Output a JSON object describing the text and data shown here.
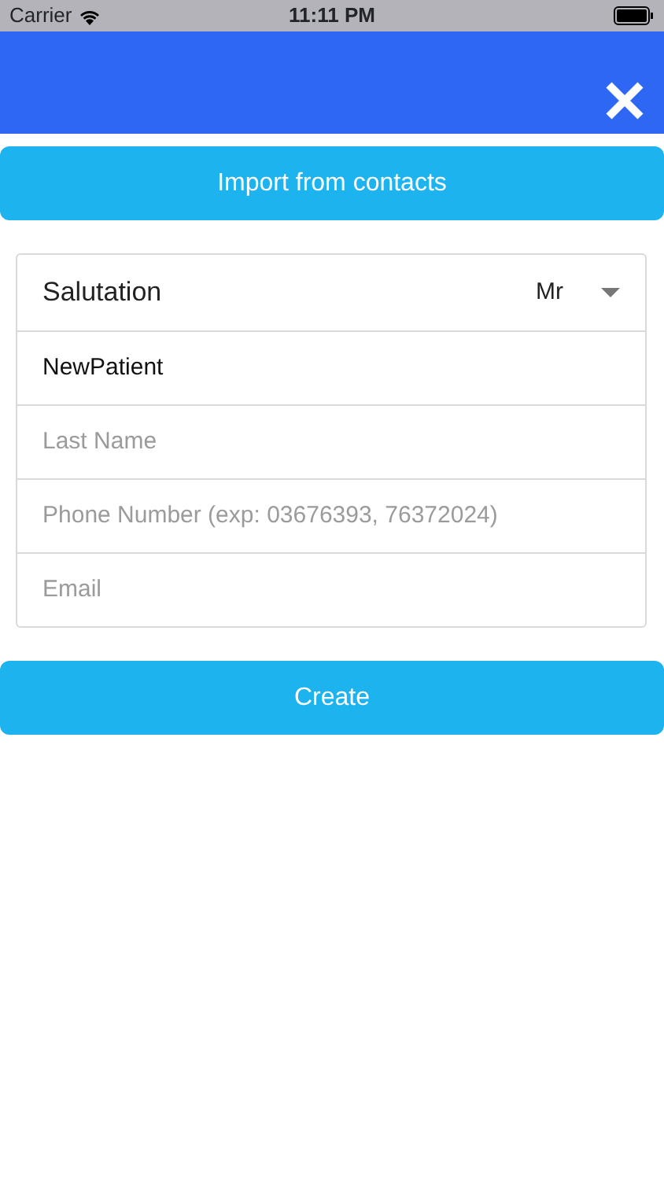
{
  "status_bar": {
    "carrier": "Carrier",
    "time": "11:11 PM"
  },
  "import_button": "Import from contacts",
  "fields": [
    {
      "kind": "select",
      "label": "Salutation",
      "value": "Mr"
    },
    {
      "kind": "input",
      "value": "NewPatient"
    },
    {
      "kind": "input",
      "placeholder": "Last Name"
    },
    {
      "kind": "input",
      "placeholder": "Phone Number (exp: 03676393, 76372024)"
    },
    {
      "kind": "input",
      "placeholder": "Email"
    }
  ],
  "create_button": "Create"
}
